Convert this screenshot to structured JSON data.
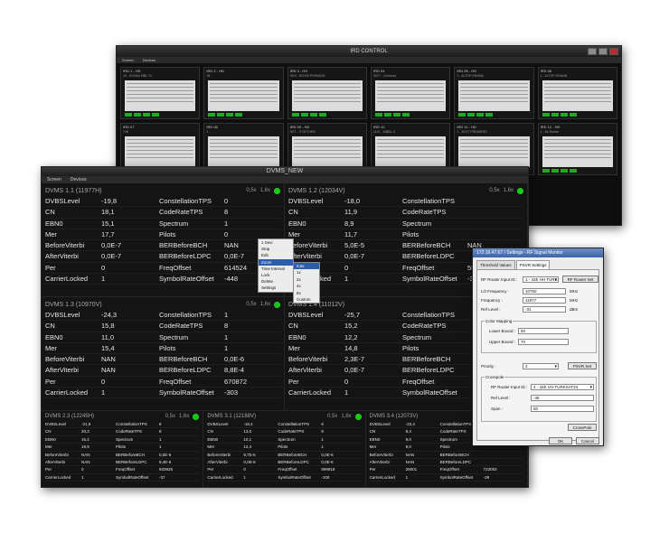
{
  "ird_window": {
    "title": "IRD CONTROL",
    "menu": [
      "Screen",
      "Devices"
    ],
    "cards": [
      {
        "title": "IRD 1 - HD",
        "sub": "18 - KOVAN MBL TV"
      },
      {
        "title": "IRD 2 - HD",
        "sub": "18 -"
      },
      {
        "title": "IRD 3 - HD",
        "sub": "HKD - BOVIS PREMIUM"
      },
      {
        "title": "IRD 04",
        "sub": "3077 - Comeras"
      },
      {
        "title": "IRD 05 - HD",
        "sub": "1 - ALTOP DRAMA"
      },
      {
        "title": "IRD 06",
        "sub": "1 - ALTOP DRAMA"
      },
      {
        "title": "IRD 07",
        "sub": "748"
      },
      {
        "title": "IRD 08",
        "sub": "1 -"
      },
      {
        "title": "IRD 09 - HD",
        "sub": "DET - CYM TURK"
      },
      {
        "title": "IRD 10",
        "sub": "1101 - KIBBL-C"
      },
      {
        "title": "IRD 11 - HD",
        "sub": "1 - 3KOT PREMIERS"
      },
      {
        "title": "IRD 12 - HD",
        "sub": "1 - Mr.Sanbe"
      }
    ]
  },
  "dvms_window": {
    "title": "DVMS_NEW",
    "menu": [
      "Screen",
      "Devices"
    ],
    "big_panels": [
      {
        "title": "DVMS 1.1 (11977H)",
        "zoom": "0,5x",
        "zoom2": "1,6x",
        "rows": [
          [
            "DVBSLevel",
            "-19,8",
            "ConstellationTPS",
            "0"
          ],
          [
            "CN",
            "18,1",
            "CodeRateTPS",
            "8"
          ],
          [
            "EBN0",
            "15,1",
            "Spectrum",
            "1"
          ],
          [
            "Mer",
            "17,7",
            "Pilots",
            "0"
          ],
          [
            "BeforeViterbi",
            "0,0E-7",
            "BERBeforeBCH",
            "NAN"
          ],
          [
            "AfterViterbi",
            "0,0E-7",
            "BERBeforeLDPC",
            "0,0E-7"
          ],
          [
            "Per",
            "0",
            "FreqOffset",
            "614524"
          ],
          [
            "CarrierLocked",
            "1",
            "SymbolRateOffset",
            "-448"
          ]
        ]
      },
      {
        "title": "DVMS 1.2 (12034V)",
        "zoom": "0,5x",
        "zoom2": "1,6x",
        "rows": [
          [
            "DVBSLevel",
            "-18,0",
            "ConstellationTPS",
            ""
          ],
          [
            "CN",
            "11,9",
            "CodeRateTPS",
            ""
          ],
          [
            "EBN0",
            "8,9",
            "Spectrum",
            ""
          ],
          [
            "Mer",
            "11,7",
            "Pilots",
            ""
          ],
          [
            "BeforeViterbi",
            "5,0E-5",
            "BERBeforeBCH",
            "NAN"
          ],
          [
            "AfterViterbi",
            "0,0E-7",
            "BERBeforeLDPC",
            ""
          ],
          [
            "Per",
            "0",
            "FreqOffset",
            "55"
          ],
          [
            "CarrierLocked",
            "1",
            "SymbolRateOffset",
            "-3"
          ]
        ]
      },
      {
        "title": "DVMS 1.3 (10970V)",
        "zoom": "0,5x",
        "zoom2": "1,6x",
        "rows": [
          [
            "DVBSLevel",
            "-24,3",
            "ConstellationTPS",
            "1"
          ],
          [
            "CN",
            "15,8",
            "CodeRateTPS",
            "8"
          ],
          [
            "EBN0",
            "11,0",
            "Spectrum",
            "1"
          ],
          [
            "Mer",
            "15,4",
            "Pilots",
            "1"
          ],
          [
            "BeforeViterbi",
            "NAN",
            "BERBeforeBCH",
            "0,0E-6"
          ],
          [
            "AfterViterbi",
            "NAN",
            "BERBeforeLDPC",
            "8,8E-4"
          ],
          [
            "Per",
            "0",
            "FreqOffset",
            "670872"
          ],
          [
            "CarrierLocked",
            "1",
            "SymbolRateOffset",
            "-303"
          ]
        ]
      },
      {
        "title": "DVMS 1.4 (11012V)",
        "zoom": "0,5x",
        "zoom2": "1,6x",
        "rows": [
          [
            "DVBSLevel",
            "-25,7",
            "ConstellationTPS",
            ""
          ],
          [
            "CN",
            "15,2",
            "CodeRateTPS",
            ""
          ],
          [
            "EBN0",
            "12,2",
            "Spectrum",
            ""
          ],
          [
            "Mer",
            "14,8",
            "Pilots",
            ""
          ],
          [
            "BeforeViterbi",
            "2,3E-7",
            "BERBeforeBCH",
            ""
          ],
          [
            "AfterViterbi",
            "0,0E-7",
            "BERBeforeLDPC",
            ""
          ],
          [
            "Per",
            "0",
            "FreqOffset",
            ""
          ],
          [
            "CarrierLocked",
            "1",
            "SymbolRateOffset",
            ""
          ]
        ]
      }
    ],
    "small_panels": [
      {
        "title": "DVMS 2.3 (12245H)",
        "zoom": "0,5x",
        "zoom2": "1,6x",
        "rows": [
          [
            "DVBSLevel",
            "-21,9",
            "ConstellationTPS",
            "8"
          ],
          [
            "CN",
            "20,3",
            "CodeRateTPS",
            "8"
          ],
          [
            "EBN0",
            "15,2",
            "Spectrum",
            "1"
          ],
          [
            "Mer",
            "19,9",
            "Pilots",
            "1"
          ],
          [
            "BeforeViterbi",
            "NAN",
            "BERBeforeBCH",
            "0,0E-6"
          ],
          [
            "AfterViterbi",
            "NAN",
            "BERBeforeLDPC",
            "9,4E-6"
          ],
          [
            "Per",
            "0",
            "FreqOffset",
            "933925"
          ],
          [
            "CarrierLocked",
            "1",
            "SymbolRateOffset",
            "-37"
          ]
        ]
      },
      {
        "title": "DVMS 3.1 (12188V)",
        "zoom": "0,5x",
        "zoom2": "1,6x",
        "rows": [
          [
            "DVBSLevel",
            "-18,4",
            "ConstellationTPS",
            "6"
          ],
          [
            "CN",
            "13,0",
            "CodeRateTPS",
            "8"
          ],
          [
            "EBN0",
            "10,1",
            "Spectrum",
            "1"
          ],
          [
            "Mer",
            "12,4",
            "Pilots",
            "1"
          ],
          [
            "BeforeViterbi",
            "9,7E-6",
            "BERBeforeBCH",
            "0,0E-6"
          ],
          [
            "AfterViterbi",
            "0,0E-6",
            "BERBeforeLDPC",
            "0,0E-6"
          ],
          [
            "Per",
            "0",
            "FreqOffset",
            "899918"
          ],
          [
            "CarrierLocked",
            "1",
            "SymbolRateOffset",
            "-100"
          ]
        ]
      },
      {
        "title": "DVMS 3.4 (12073V)",
        "zoom": "0,5x",
        "zoom2": "1,6x",
        "rows": [
          [
            "DVBSLevel",
            "-22,4",
            "ConstellationTPS",
            ""
          ],
          [
            "CN",
            "9,4",
            "CodeRateTPS",
            ""
          ],
          [
            "EBN0",
            "9,0",
            "Spectrum",
            ""
          ],
          [
            "Mer",
            "9,0",
            "Pilots",
            ""
          ],
          [
            "BeforeViterbi",
            "NAN",
            "BERBeforeBCH",
            ""
          ],
          [
            "AfterViterbi",
            "NAN",
            "BERBeforeLDPC",
            ""
          ],
          [
            "Per",
            "29001",
            "FreqOffset",
            "722002"
          ],
          [
            "CarrierLocked",
            "1",
            "SymbolRateOffset",
            "-28"
          ]
        ]
      }
    ]
  },
  "context_menu": [
    "1 Sevi",
    "Stop",
    "Edit",
    "Zoom",
    "Time Interval",
    "Lock",
    "Delete",
    "Settings"
  ],
  "submenu": [
    "0,5x",
    "1x",
    "2x",
    "4x",
    "8x",
    "Custom"
  ],
  "settings_dialog": {
    "title": "172.16.47.67 / Settings - RF Signal Monitor",
    "tabs": [
      "Threshold Values",
      "PSVR Settings"
    ],
    "rf_router_input_label": "RF Router Input ID :",
    "rf_router_input_value": "1 - 42E HH TURK",
    "rf_router_set": "RF Router Set",
    "lo_freq_label": "LO Frequency :",
    "lo_freq_value": "10750",
    "lo_freq_unit": "MHz",
    "freq_label": "Frequency :",
    "freq_value": "11977",
    "freq_unit": "MHz",
    "ref_level_label": "Ref Level :",
    "ref_level_value": "-31",
    "ref_level_unit": "dBm",
    "color_mapping_label": "Color Mapping",
    "lower_bound_label": "Lower Bound :",
    "lower_bound_value": "50",
    "upper_bound_label": "Upper Bound :",
    "upper_bound_value": "70",
    "priority_label": "Priority :",
    "priority_value": "2",
    "psvr_set": "PSVR Set",
    "crosspole_label": "Crosspole",
    "cp_input_label": "RF Router Input ID :",
    "cp_input_value": "4 - 42E VH-TURKSAT34",
    "cp_ref_label": "Ref Level :",
    "cp_ref_value": "-46",
    "span_label": "Span :",
    "span_value": "50",
    "crosspole_btn": "CrossPole",
    "ok": "OK",
    "cancel": "Cancel"
  }
}
